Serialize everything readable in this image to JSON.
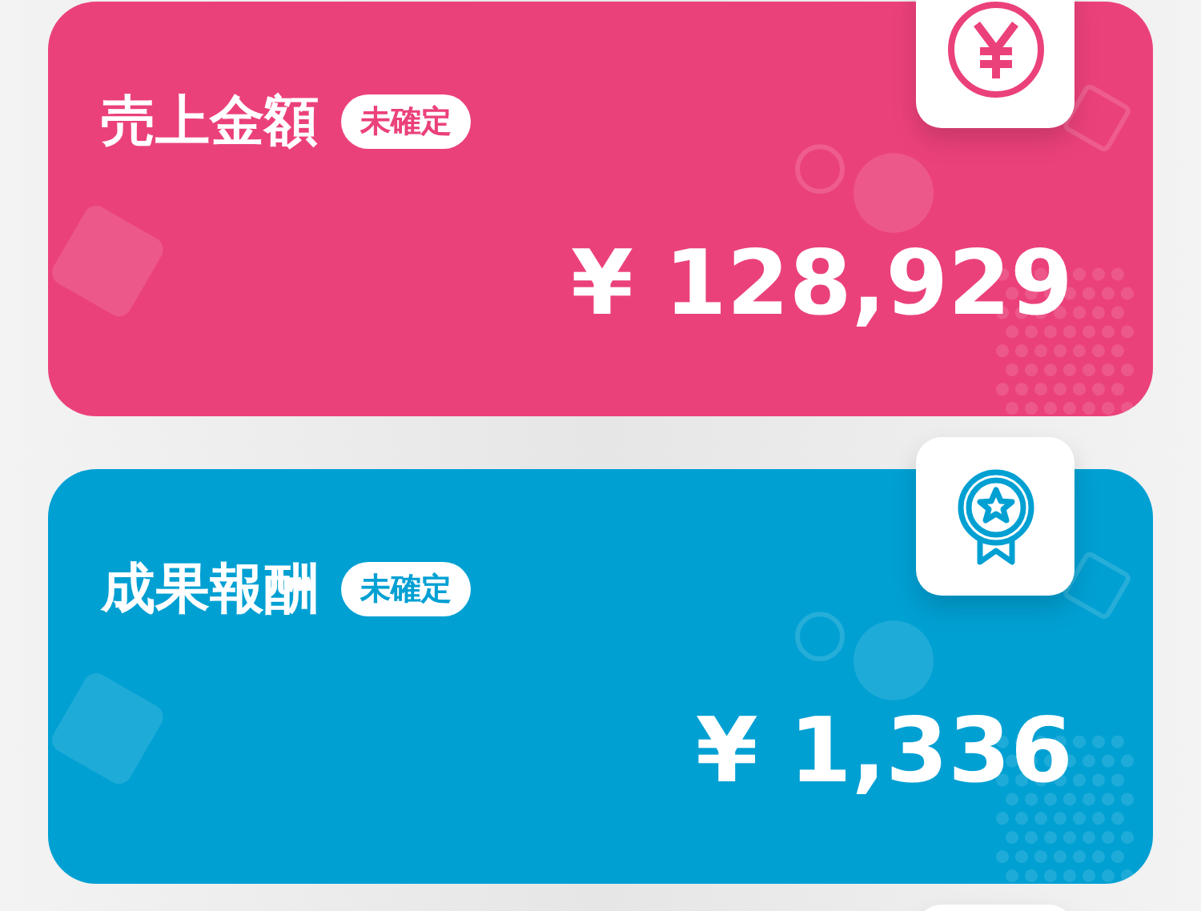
{
  "cards": [
    {
      "kind": "sales",
      "title": "売上金額",
      "badge": "未確定",
      "amount": "¥ 128,929",
      "color": "#eb417a"
    },
    {
      "kind": "reward",
      "title": "成果報酬",
      "badge": "未確定",
      "amount": "¥ 1,336",
      "color": "#00a0d3"
    }
  ]
}
